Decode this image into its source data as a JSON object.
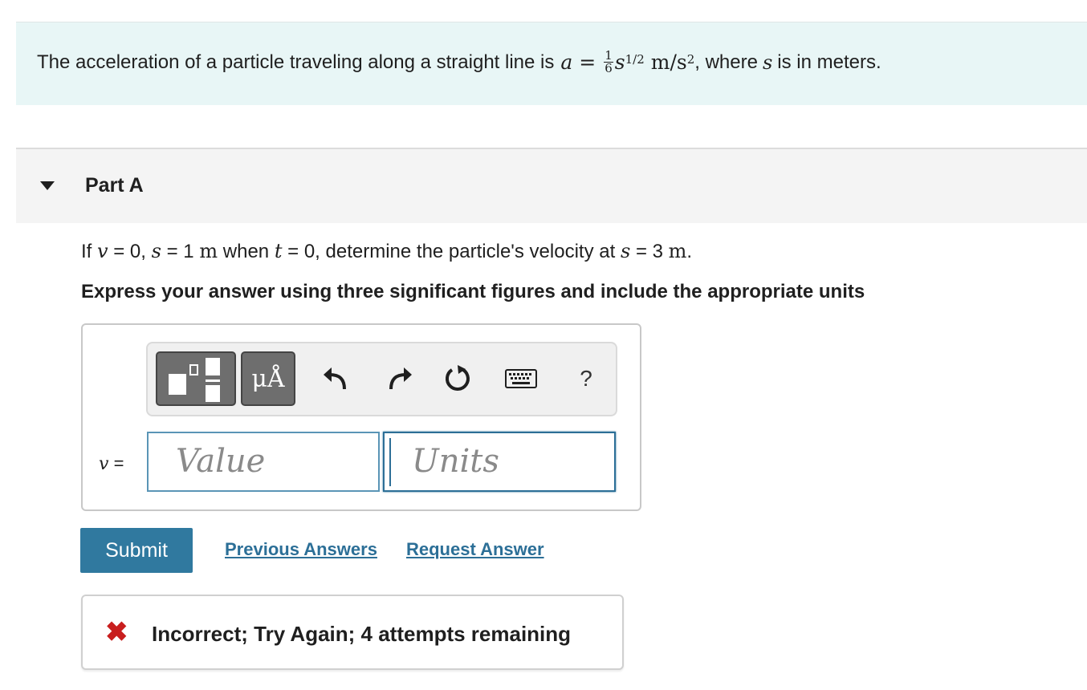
{
  "problem": {
    "text_before": "The acceleration of a particle traveling along a straight line is",
    "eq_var": "a",
    "eq_equals": "=",
    "frac_num": "1",
    "frac_den": "6",
    "eq_base": "s",
    "eq_exp": "1/2",
    "eq_unit": "m/s",
    "eq_unit_exp": "2",
    "text_after": ", where",
    "after_var": "s",
    "text_end": "is in meters."
  },
  "part": {
    "title": "Part A"
  },
  "question": {
    "if": "If",
    "v": "v",
    "eq0": "= 0,",
    "s": "s",
    "eq1": "= 1",
    "m1": "m",
    "when": "when",
    "t": "t",
    "eq2": "= 0, determine the particle's velocity at",
    "s2": "s",
    "eq3": "= 3",
    "m2": "m",
    "dot": "."
  },
  "instruction": "Express your answer using three significant figures and include the appropriate units",
  "toolbar": {
    "symbols_label": "μÅ",
    "help_label": "?",
    "icons": [
      "templates-icon",
      "undo-icon",
      "redo-icon",
      "reset-icon",
      "keyboard-icon",
      "help-icon"
    ]
  },
  "answer": {
    "var_label": "v",
    "equals": "=",
    "value_placeholder": "Value",
    "units_placeholder": "Units"
  },
  "actions": {
    "submit": "Submit",
    "previous": "Previous Answers",
    "request": "Request Answer"
  },
  "feedback": {
    "mark": "✖",
    "text": "Incorrect; Try Again; 4 attempts remaining",
    "color": "#c81e1e"
  },
  "colors": {
    "accent": "#30799f",
    "intro_bg": "#e8f6f6",
    "part_bg": "#f4f4f4"
  }
}
